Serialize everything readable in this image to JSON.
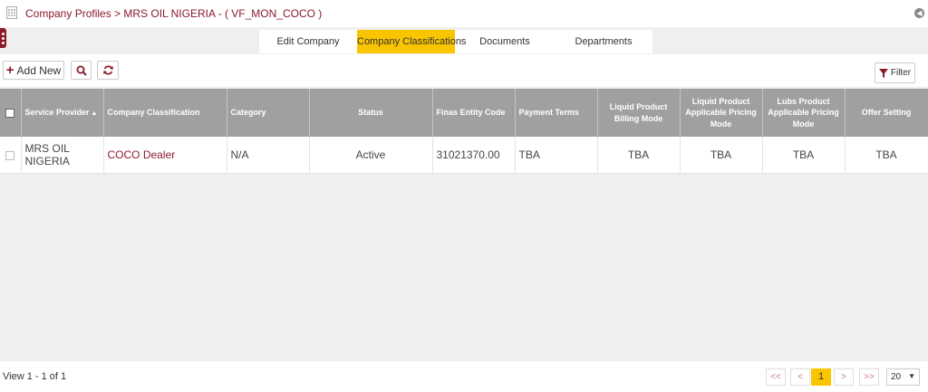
{
  "breadcrumb": "Company Profiles > MRS OIL NIGERIA - ( VF_MON_COCO )",
  "tabs": [
    {
      "label": "Edit Company",
      "active": false
    },
    {
      "label": "Company Classifications",
      "active": true
    },
    {
      "label": "Documents",
      "active": false
    },
    {
      "label": "Departments",
      "active": false
    }
  ],
  "toolbar": {
    "add_new_label": "Add New",
    "search_icon": "search-icon",
    "refresh_icon": "refresh-icon",
    "filter_label": "Filter"
  },
  "table": {
    "columns": [
      "Service Provider",
      "Company Classification",
      "Category",
      "Status",
      "Finas Entity Code",
      "Payment Terms",
      "Liquid Product Billing Mode",
      "Liquid Product Applicable Pricing Mode",
      "Lubs Product Applicable Pricing Mode",
      "Offer Setting"
    ],
    "rows": [
      {
        "service_provider": "MRS OIL NIGERIA",
        "company_classification": "COCO Dealer",
        "category": "N/A",
        "status": "Active",
        "finas_entity_code": "31021370.00",
        "payment_terms": "TBA",
        "liquid_billing_mode": "TBA",
        "liquid_pricing_mode": "TBA",
        "lubs_pricing_mode": "TBA",
        "offer_setting": "TBA"
      }
    ]
  },
  "footer": {
    "view_text": "View 1 - 1 of 1",
    "first_label": "<<",
    "prev_label": "<",
    "current_page": "1",
    "next_label": ">",
    "last_label": ">>",
    "page_size": "20"
  },
  "colors": {
    "brand": "#8b1a2b",
    "accent": "#f9c400",
    "header_bg": "#a0a0a0"
  }
}
